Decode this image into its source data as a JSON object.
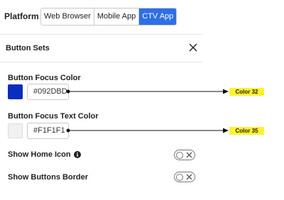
{
  "platform": {
    "label": "Platform",
    "options": [
      {
        "label": "Web Browser",
        "active": false
      },
      {
        "label": "Mobile App",
        "active": false
      },
      {
        "label": "CTV App",
        "active": true
      }
    ]
  },
  "section": {
    "title": "Button Sets",
    "close_icon": "close-icon"
  },
  "fields": {
    "focus_color": {
      "label": "Button Focus Color",
      "value": "#092DBD",
      "swatch": "#092DBD"
    },
    "focus_text_color": {
      "label": "Button Focus Text Color",
      "value": "#F1F1F1",
      "swatch": "#F1F1F1"
    }
  },
  "toggles": {
    "show_home_icon": {
      "label": "Show Home Icon",
      "icon": "info-icon",
      "on": false
    },
    "show_buttons_border": {
      "label": "Show Buttons Border",
      "on": false
    }
  },
  "annotations": [
    {
      "text": "Color 32"
    },
    {
      "text": "Color 35"
    }
  ],
  "colors": {
    "active_segment": "#2f6fe6",
    "annotation_tag": "#fdf22f"
  }
}
